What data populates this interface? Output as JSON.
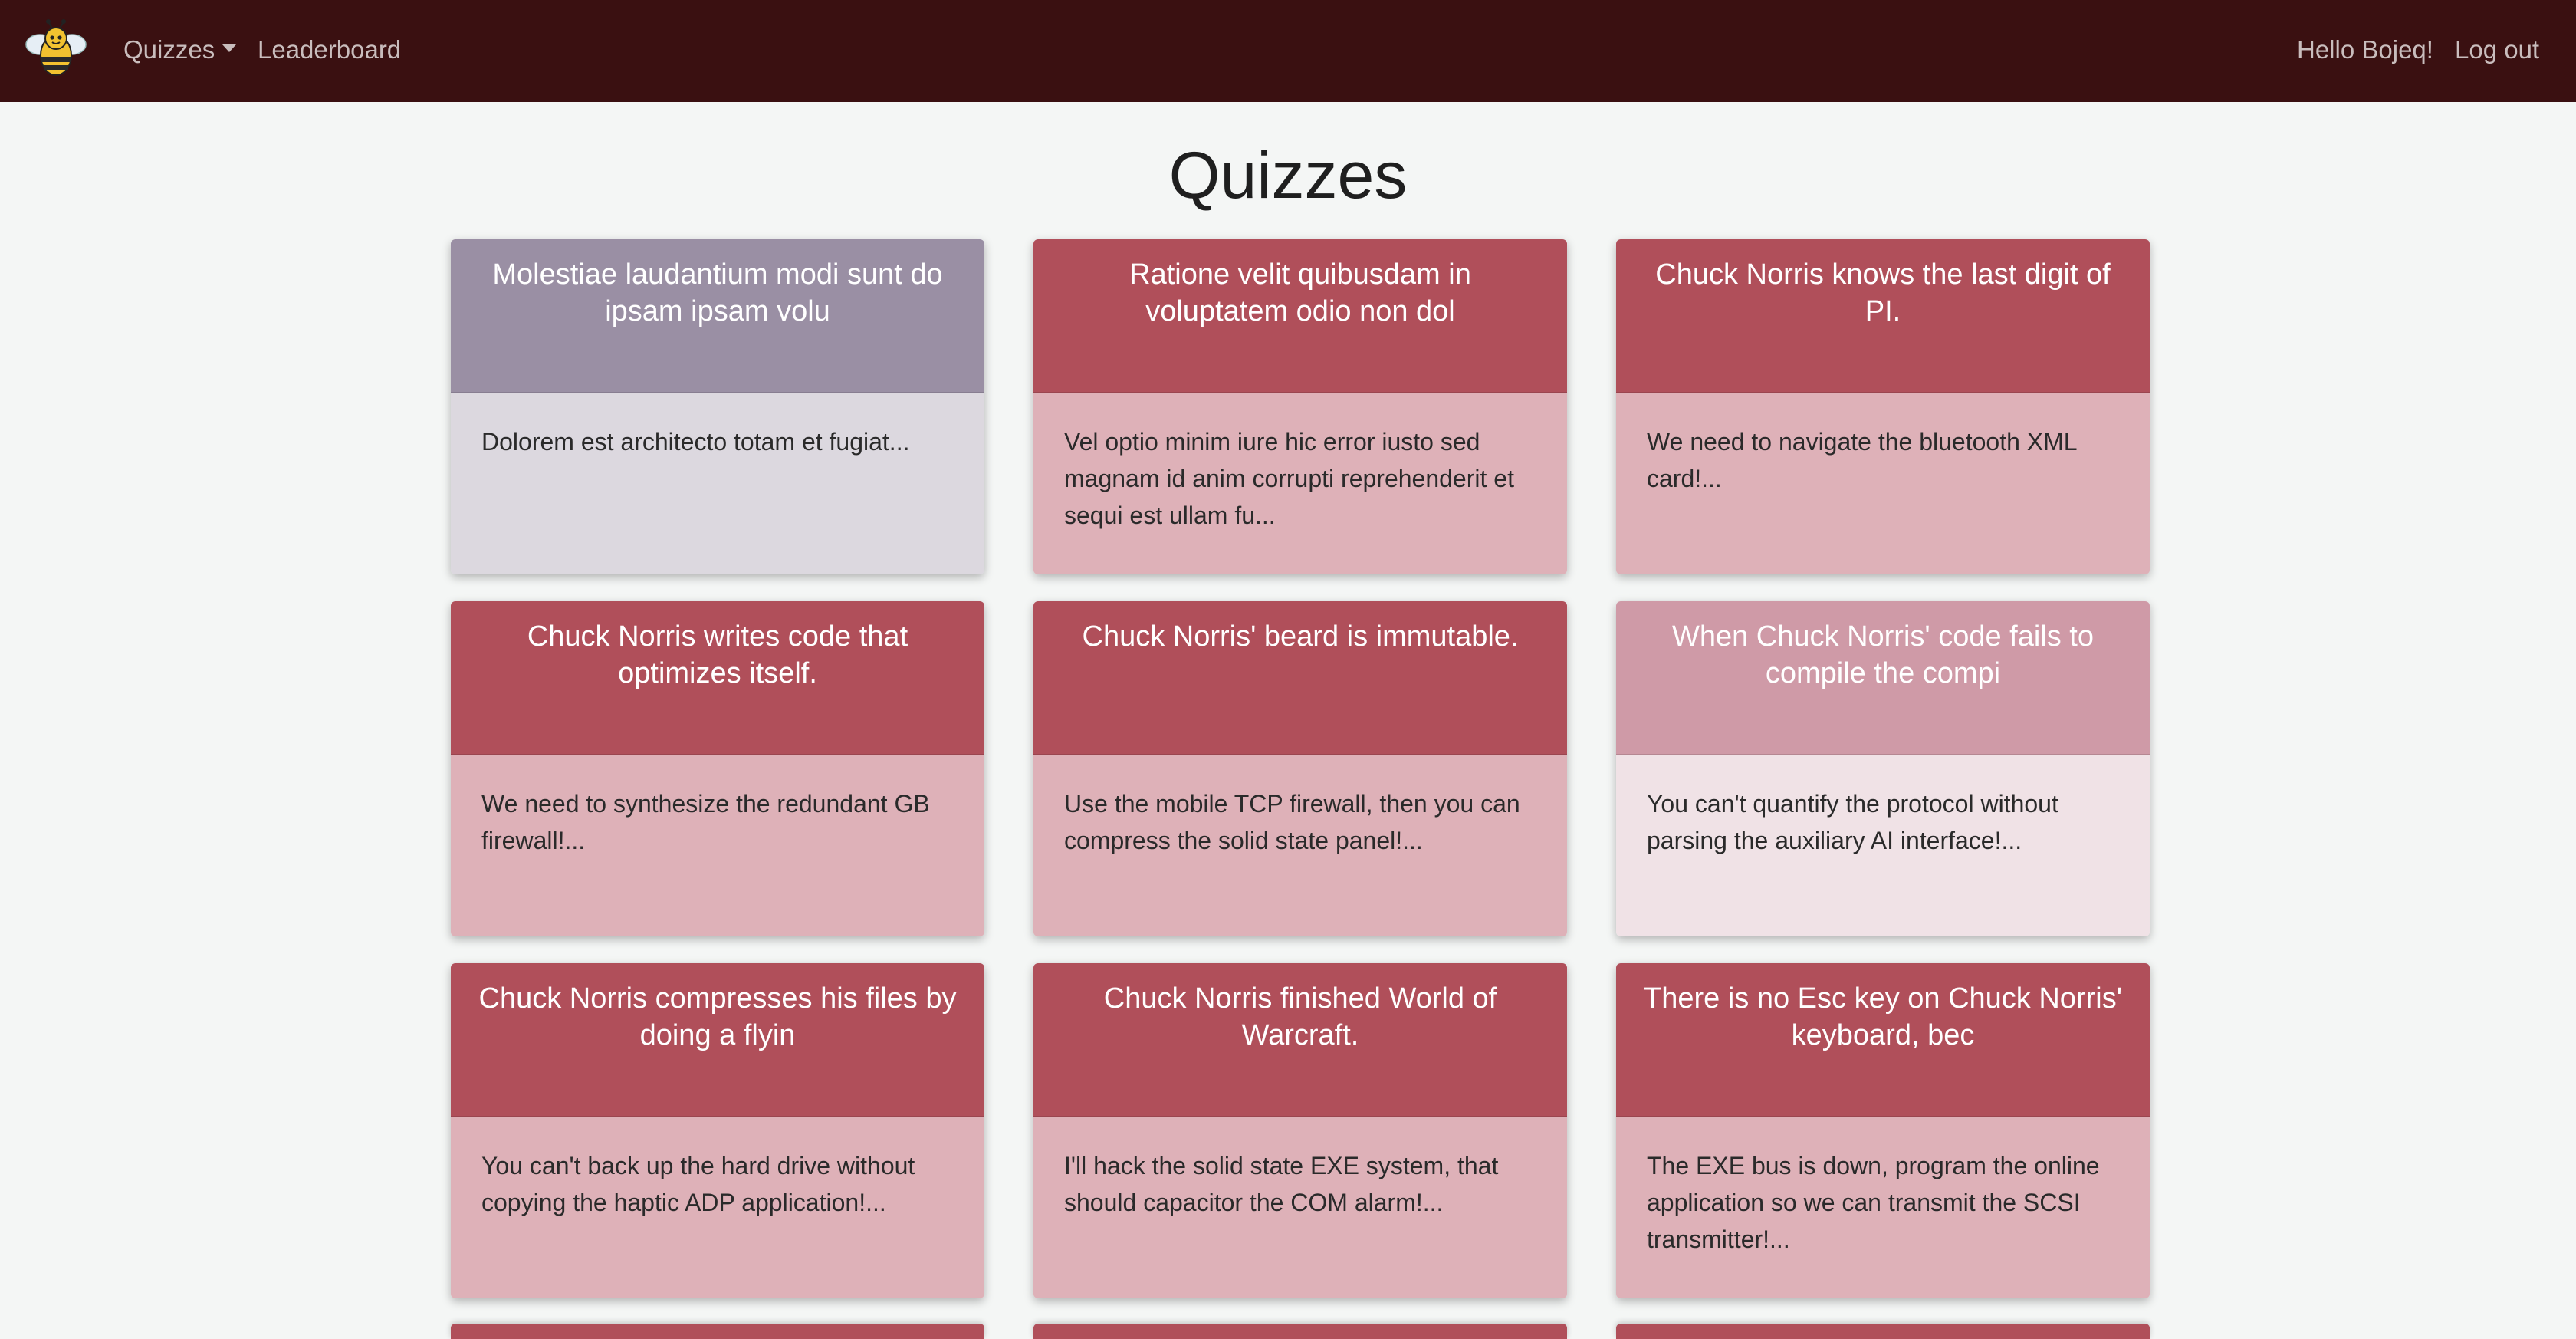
{
  "navbar": {
    "logo_icon": "bee-icon",
    "quizzes_label": "Quizzes",
    "leaderboard_label": "Leaderboard",
    "greeting": "Hello Bojeq!",
    "logout_label": "Log out"
  },
  "page": {
    "title": "Quizzes"
  },
  "colors": {
    "navbar": "#3a1011",
    "header_red": "#b04f5a",
    "body_red": "#deb1b8",
    "header_gray": "#9a8fa4",
    "body_gray": "#dcd8df",
    "header_pink": "#cf9aa7",
    "body_pink": "#f0e2e6"
  },
  "quizzes": [
    {
      "title": "Molestiae laudantium modi sunt do ipsam ipsam volu",
      "description": "Dolorem est architecto totam et fugiat...",
      "theme": "gray"
    },
    {
      "title": "Ratione velit quibusdam in voluptatem odio non dol",
      "description": "Vel optio minim iure hic error iusto sed magnam id anim corrupti reprehenderit et sequi est ullam fu...",
      "theme": "red"
    },
    {
      "title": "Chuck Norris knows the last digit of PI.",
      "description": "We need to navigate the bluetooth XML card!...",
      "theme": "red"
    },
    {
      "title": "Chuck Norris writes code that optimizes itself.",
      "description": "We need to synthesize the redundant GB firewall!...",
      "theme": "red"
    },
    {
      "title": "Chuck Norris' beard is immutable.",
      "description": "Use the mobile TCP firewall, then you can compress the solid state panel!...",
      "theme": "red"
    },
    {
      "title": "When Chuck Norris' code fails to compile the compi",
      "description": "You can't quantify the protocol without parsing the auxiliary AI interface!...",
      "theme": "pink"
    },
    {
      "title": "Chuck Norris compresses his files by doing a flyin",
      "description": "You can't back up the hard drive without copying the haptic ADP application!...",
      "theme": "red"
    },
    {
      "title": "Chuck Norris finished World of Warcraft.",
      "description": "I'll hack the solid state EXE system, that should capacitor the COM alarm!...",
      "theme": "red"
    },
    {
      "title": "There is no Esc key on Chuck Norris' keyboard, bec",
      "description": "The EXE bus is down, program the online application so we can transmit the SCSI transmitter!...",
      "theme": "red"
    }
  ]
}
